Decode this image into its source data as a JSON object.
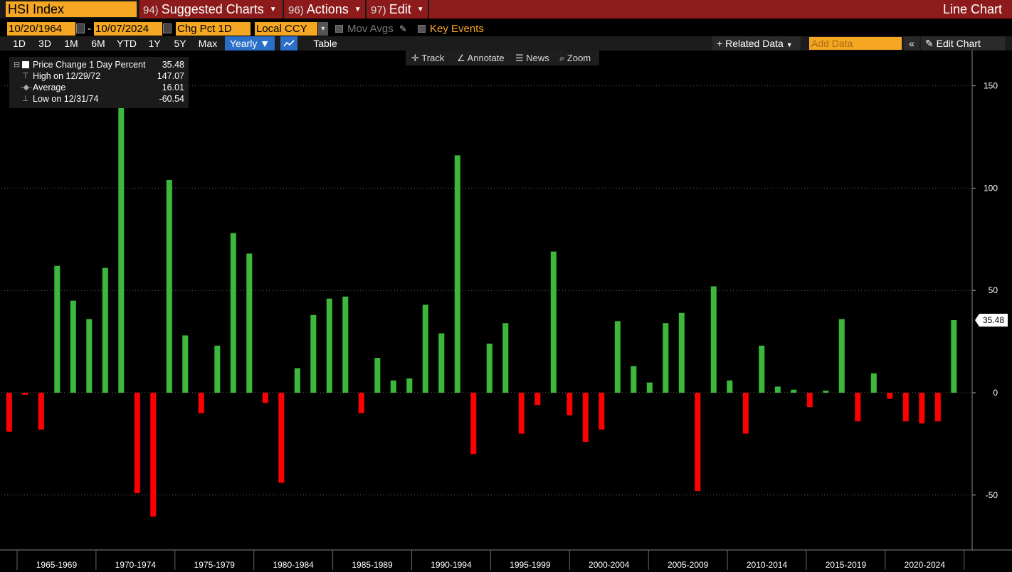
{
  "header": {
    "ticker": "HSI Index",
    "menus": [
      {
        "num": "94)",
        "label": "Suggested Charts"
      },
      {
        "num": "96)",
        "label": "Actions"
      },
      {
        "num": "97)",
        "label": "Edit"
      }
    ],
    "chart_type": "Line Chart"
  },
  "controls": {
    "start_date": "10/20/1964",
    "date_sep": "-",
    "end_date": "10/07/2024",
    "field": "Chg Pct 1D",
    "currency": "Local CCY",
    "mov_avgs": "Mov Avgs",
    "key_events": "Key Events"
  },
  "periods": [
    "1D",
    "3D",
    "1M",
    "6M",
    "YTD",
    "1Y",
    "5Y",
    "Max"
  ],
  "frequency": "Yearly",
  "table_label": "Table",
  "related_data": "Related Data",
  "add_data_placeholder": "Add Data",
  "edit_chart": "Edit Chart",
  "chart_tools": [
    "Track",
    "Annotate",
    "News",
    "Zoom"
  ],
  "legend": {
    "series_name": "Price Change 1 Day Percent",
    "series_value": "35.48",
    "high_label": "High on 12/29/72",
    "high_value": "147.07",
    "avg_label": "Average",
    "avg_value": "16.01",
    "low_label": "Low on 12/31/74",
    "low_value": "-60.54"
  },
  "colors": {
    "positive": "#3cb93c",
    "negative": "#ff0000",
    "accent": "#f5a623",
    "header_red": "#8e1b1b"
  },
  "chart_data": {
    "type": "bar",
    "x_start_year": 1964,
    "values": [
      -19,
      -1,
      -18,
      62,
      45,
      36,
      61,
      147.07,
      -49,
      -60.54,
      104,
      28,
      -10,
      23,
      78,
      68,
      -5,
      -44,
      12,
      38,
      46,
      47,
      -10,
      17,
      6,
      7,
      43,
      29,
      116,
      -30,
      24,
      34,
      -20,
      -6,
      69,
      -11,
      -24,
      -18,
      35,
      13,
      5,
      34,
      39,
      -48,
      52,
      6,
      -20,
      23,
      3,
      1.5,
      -7,
      1,
      36,
      -14,
      9.5,
      -3,
      -14,
      -15,
      -14,
      35.48
    ],
    "ylim": [
      -75,
      160
    ],
    "yticks": [
      -50,
      0,
      50,
      100,
      150
    ],
    "period_labels": [
      "1965-1969",
      "1970-1974",
      "1975-1979",
      "1980-1984",
      "1985-1989",
      "1990-1994",
      "1995-1999",
      "2000-2004",
      "2005-2009",
      "2010-2014",
      "2015-2019",
      "2020-2024"
    ],
    "last_value_label": "35.48",
    "grid": true
  }
}
